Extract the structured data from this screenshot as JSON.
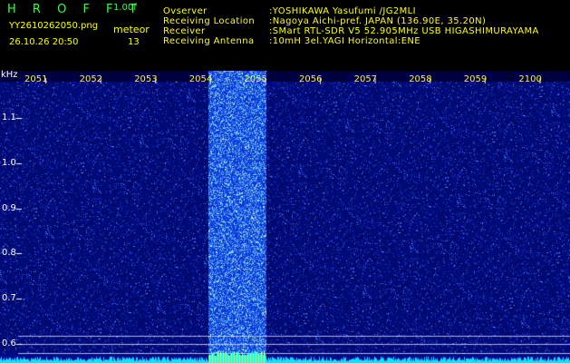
{
  "header": {
    "app_title": "H R O F F T",
    "version": "1.00f",
    "filename": "YY2610262050.png",
    "datetime": "26.10.26 20:50",
    "meteor_label": "meteor",
    "meteor_count": "13",
    "info_labels": [
      "Ovserver",
      "Receiving Location",
      "Receiver",
      "Receiving Antenna"
    ],
    "info_values": [
      ":YOSHIKAWA Yasufumi /JG2MLI",
      ":Nagoya Aichi-pref. JAPAN (136.90E, 35.20N)",
      ":SMart RTL-SDR V5 52.905MHz USB HIGASHIMURAYAMA",
      ":10mH 3el.YAGI Horizontal:ENE"
    ]
  },
  "axis": {
    "y_unit": "kHz",
    "y_ticks": [
      "1.1",
      "1.0",
      "0.9",
      "0.8",
      "0.7",
      "0.6"
    ],
    "x_ticks": [
      "2051",
      "2052",
      "2053",
      "2054",
      "2055",
      "2056",
      "2057",
      "2058",
      "2059",
      "2100"
    ]
  },
  "colors": {
    "background": "#000000",
    "spectrum_base": "#000a8c",
    "signal": "#4c8cff",
    "baseline": "#00ffff",
    "label_green": "#32ff40",
    "label_yellow": "#ffff00"
  }
}
